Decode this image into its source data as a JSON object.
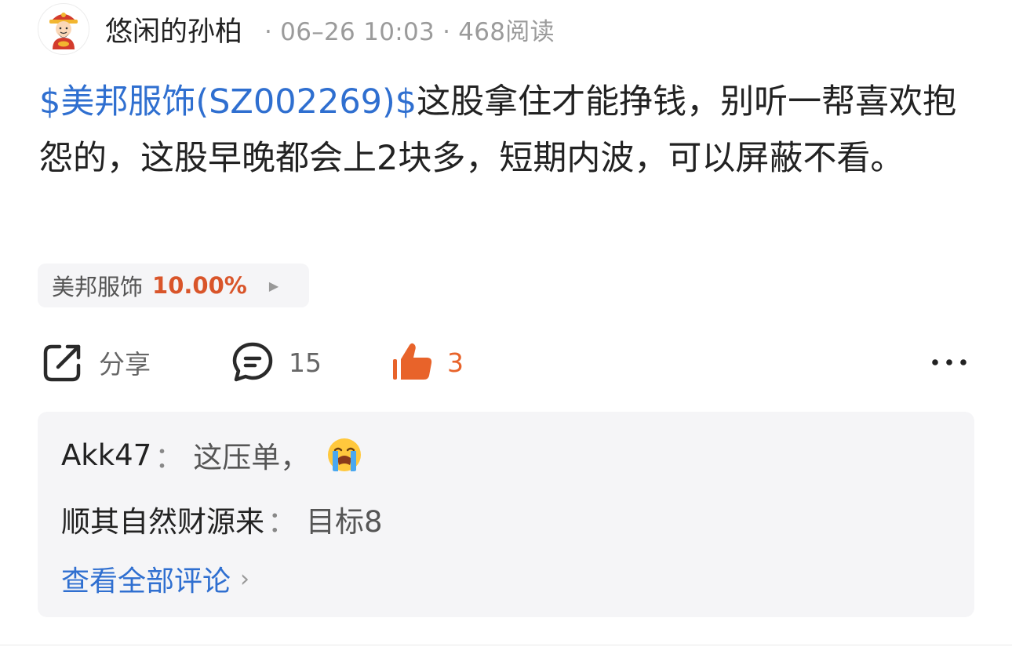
{
  "post": {
    "author": "悠闲的孙柏",
    "date": "06–26 10:03",
    "reads": "468阅读",
    "separator": "·",
    "stock_link": "$美邦服饰(SZ002269)$",
    "content": "这股拿住才能挣钱，别听一帮喜欢抱怨的，这股早晚都会上2块多，短期内波，可以屏蔽不看。"
  },
  "stock_chip": {
    "name": "美邦服饰",
    "change": "10.00%",
    "arrow": "▶"
  },
  "actions": {
    "share_label": "分享",
    "comment_count": "15",
    "like_count": "3"
  },
  "comments": {
    "items": [
      {
        "user": "Akk47",
        "colon": "：",
        "text": "这压单，",
        "emoji": "loudly-crying-face"
      },
      {
        "user": "顺其自然财源来",
        "colon": "：",
        "text": "目标8"
      }
    ],
    "view_all": "查看全部评论",
    "chevron": "›"
  },
  "colors": {
    "link_blue": "#2f6fd0",
    "like_orange": "#e8632a",
    "up_red": "#d9552a",
    "muted_gray": "#9b9b9b",
    "comment_bg": "#f5f5f7"
  }
}
